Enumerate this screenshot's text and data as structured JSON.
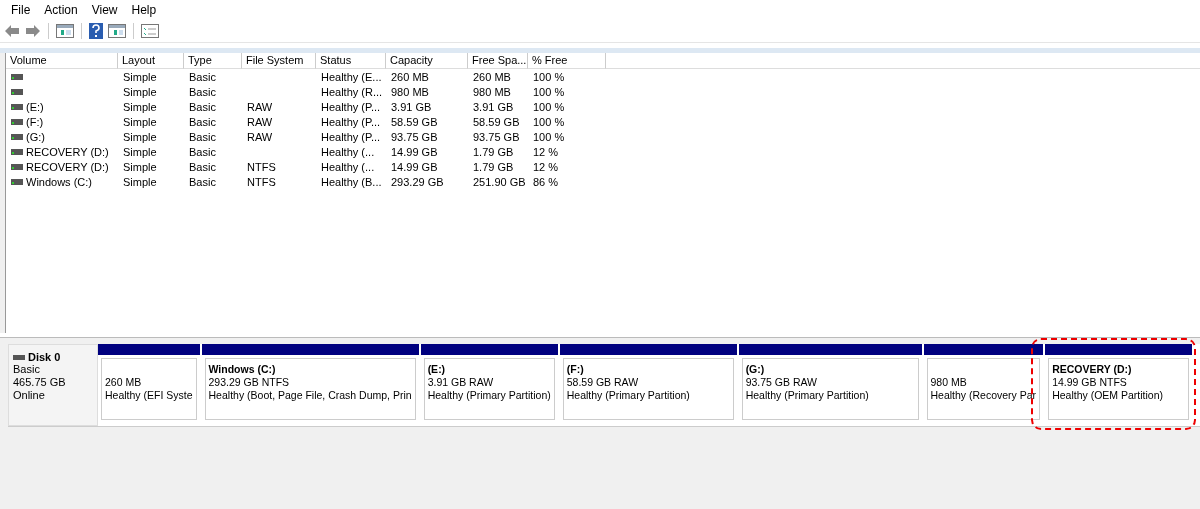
{
  "menu": [
    "File",
    "Action",
    "View",
    "Help"
  ],
  "table": {
    "columns": [
      "Volume",
      "Layout",
      "Type",
      "File System",
      "Status",
      "Capacity",
      "Free Spa...",
      "% Free"
    ],
    "rows": [
      {
        "cells": [
          "",
          "Simple",
          "Basic",
          "",
          "Healthy (E...",
          "260 MB",
          "260 MB",
          "100 %"
        ]
      },
      {
        "cells": [
          "",
          "Simple",
          "Basic",
          "",
          "Healthy (R...",
          "980 MB",
          "980 MB",
          "100 %"
        ]
      },
      {
        "cells": [
          " (E:)",
          "Simple",
          "Basic",
          "RAW",
          "Healthy (P...",
          "3.91 GB",
          "3.91 GB",
          "100 %"
        ]
      },
      {
        "cells": [
          " (F:)",
          "Simple",
          "Basic",
          "RAW",
          "Healthy (P...",
          "58.59 GB",
          "58.59 GB",
          "100 %"
        ]
      },
      {
        "cells": [
          " (G:)",
          "Simple",
          "Basic",
          "RAW",
          "Healthy (P...",
          "93.75 GB",
          "93.75 GB",
          "100 %"
        ]
      },
      {
        "cells": [
          "RECOVERY (D:)",
          "Simple",
          "Basic",
          "",
          "Healthy (...",
          "14.99 GB",
          "1.79 GB",
          "12 %"
        ]
      },
      {
        "cells": [
          "RECOVERY (D:)",
          "Simple",
          "Basic",
          "NTFS",
          "Healthy (...",
          "14.99 GB",
          "1.79 GB",
          "12 %"
        ]
      },
      {
        "cells": [
          "Windows (C:)",
          "Simple",
          "Basic",
          "NTFS",
          "Healthy (B...",
          "293.29 GB",
          "251.90 GB",
          "86 %"
        ]
      }
    ]
  },
  "disk": {
    "name": "Disk 0",
    "type": "Basic",
    "size": "465.75 GB",
    "state": "Online",
    "partitions": [
      {
        "size": "260 MB",
        "status": "Healthy (EFI Syste",
        "highlighted": false
      },
      {
        "name": "Windows  (C:)",
        "size": "293.29 GB NTFS",
        "status": "Healthy (Boot, Page File, Crash Dump, Prin",
        "highlighted": false
      },
      {
        "name": " (E:)",
        "size": "3.91 GB RAW",
        "status": "Healthy (Primary Partition)",
        "highlighted": false
      },
      {
        "name": " (F:)",
        "size": "58.59 GB RAW",
        "status": "Healthy (Primary Partition)",
        "highlighted": false
      },
      {
        "name": " (G:)",
        "size": "93.75 GB RAW",
        "status": "Healthy (Primary Partition)",
        "highlighted": false
      },
      {
        "size": "980 MB",
        "status": "Healthy (Recovery Par",
        "highlighted": false
      },
      {
        "name": "RECOVERY  (D:)",
        "size": "14.99 GB NTFS",
        "status": "Healthy (OEM Partition)",
        "highlighted": true
      }
    ]
  }
}
